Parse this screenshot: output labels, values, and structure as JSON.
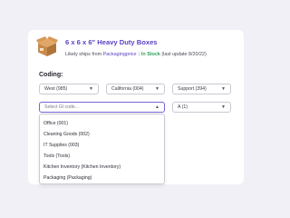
{
  "product": {
    "title": "6 x 6 x 6\" Heavy Duty Boxes",
    "ships_prefix": "Likely ships from ",
    "ships_from": "Packagingprice",
    "separator": "|",
    "stock": "In Stock",
    "last_update": "(last update 8/20/22)",
    "icon": "cardboard-box-icon"
  },
  "coding": {
    "label": "Coding:",
    "region": "West (985)",
    "state": "California (004)",
    "department": "Support (394)",
    "gl_placeholder": "Select Gl code...",
    "quantity": "A (1)",
    "gl_options": [
      "Office (001)",
      "Cleaning Goods (002)",
      "IT Supplies (003)",
      "Tools (Tools)",
      "Kitchen Inventory (Kitchen Inventory)",
      "Packaging (Packaging)"
    ]
  },
  "colors": {
    "accent": "#5b3fc4",
    "stock_green": "#2f9e5a",
    "page_bg": "#f0f0f6",
    "box_brown": "#c98a4b"
  }
}
